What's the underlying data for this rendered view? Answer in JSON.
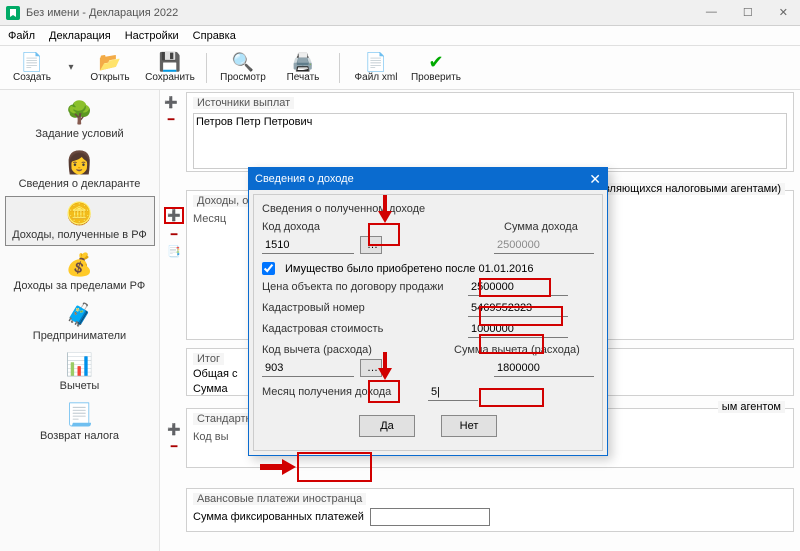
{
  "window": {
    "title": "Без имени - Декларация 2022"
  },
  "menu": {
    "file": "Файл",
    "declaration": "Декларация",
    "settings": "Настройки",
    "help": "Справка"
  },
  "toolbar": {
    "create": "Создать",
    "open": "Открыть",
    "save": "Сохранить",
    "preview": "Просмотр",
    "print": "Печать",
    "xml": "Файл xml",
    "check": "Проверить"
  },
  "sidenav": {
    "cond": "Задание условий",
    "declarant": "Сведения о декларанте",
    "income_rf": "Доходы, полученные в РФ",
    "income_abroad": "Доходы за пределами РФ",
    "entrepreneur": "Предприниматели",
    "deductions": "Вычеты",
    "tax_return": "Возврат налога"
  },
  "content": {
    "sources_header": "Источники выплат",
    "payer_name": "Петров Петр Петрович",
    "taxed_incomes_caption": "Доходы, обл…",
    "taxed_incomes_tail": "являющихся налоговыми агентами)",
    "month_col": "Месяц",
    "totals_caption": "Итог",
    "total_label": "Общая с",
    "sum_label": "Сумма",
    "standard_caption": "Стандартн…",
    "code_col": "Код вы",
    "noagent_caption": "ым агентом",
    "advance_caption": "Авансовые платежи иностранца",
    "fixed_label": "Сумма фиксированных платежей"
  },
  "modal": {
    "title": "Сведения о доходе",
    "group_title": "Сведения о полученном доходе",
    "income_code_lbl": "Код дохода",
    "income_sum_lbl": "Сумма дохода",
    "income_code_val": "1510",
    "income_sum_val": "2500000",
    "chk_label": "Имущество было приобретено после 01.01.2016",
    "sale_price_lbl": "Цена объекта по договору продажи",
    "sale_price_val": "2500000",
    "cad_num_lbl": "Кадастровый номер",
    "cad_num_val": "5469552323",
    "cad_value_lbl": "Кадастровая стоимость",
    "cad_value_val": "1000000",
    "deduct_code_lbl": "Код вычета (расхода)",
    "deduct_sum_lbl": "Сумма вычета (расхода)",
    "deduct_code_val": "903",
    "deduct_sum_val": "1800000",
    "month_lbl": "Месяц получения дохода",
    "month_val": "5|",
    "ok": "Да",
    "cancel": "Нет"
  }
}
